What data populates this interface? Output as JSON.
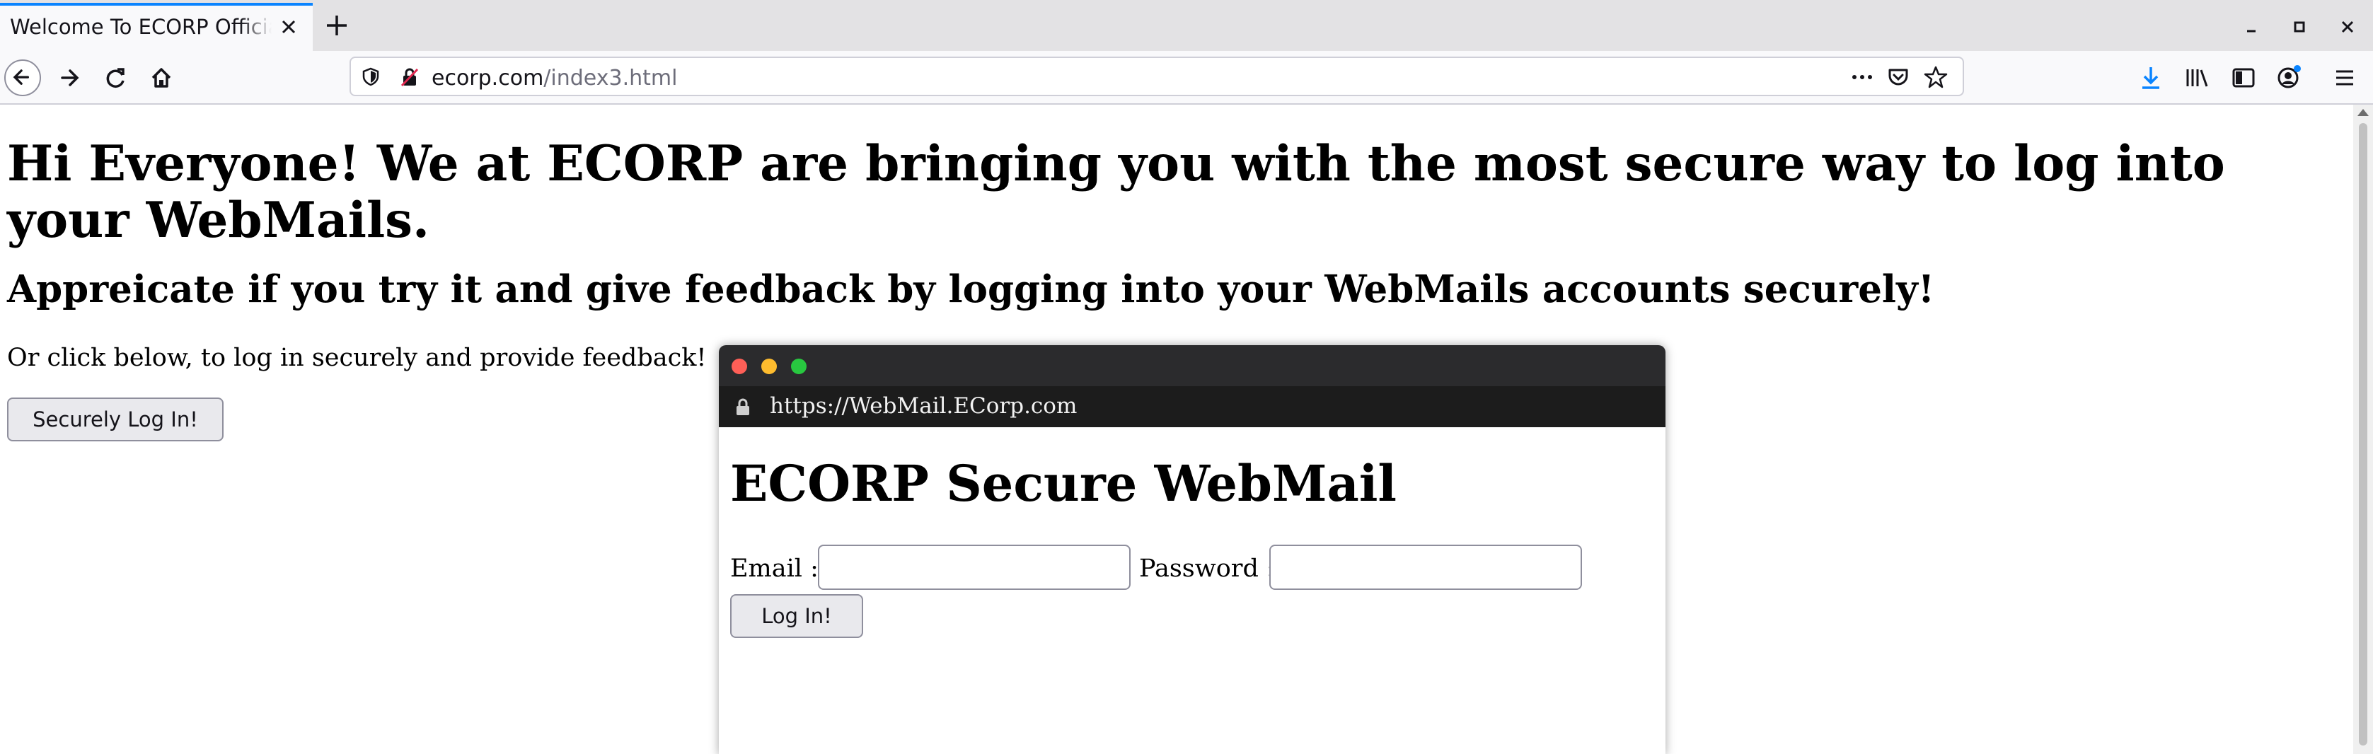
{
  "browser": {
    "tab_title": "Welcome To ECORP Official",
    "url_host": "ecorp.com",
    "url_path": "/index3.html"
  },
  "page": {
    "heading": "Hi Everyone! We at ECORP are bringing you with the most secure way to log into your WebMails.",
    "subheading": "Appreicate if you try it and give feedback by logging into your WebMails accounts securely!",
    "paragraph": "Or click below, to log in securely and provide feedback!",
    "login_button": "Securely Log In!"
  },
  "popup": {
    "url": "https://WebMail.ECorp.com",
    "title": "ECORP Secure WebMail",
    "email_label": "Email :",
    "email_value": "",
    "password_label": "Password :",
    "password_value": "",
    "login_button": "Log In!"
  },
  "colors": {
    "accent": "#0a84ff",
    "traffic_red": "#ff5f57",
    "traffic_yellow": "#febc2e",
    "traffic_green": "#28c840"
  }
}
